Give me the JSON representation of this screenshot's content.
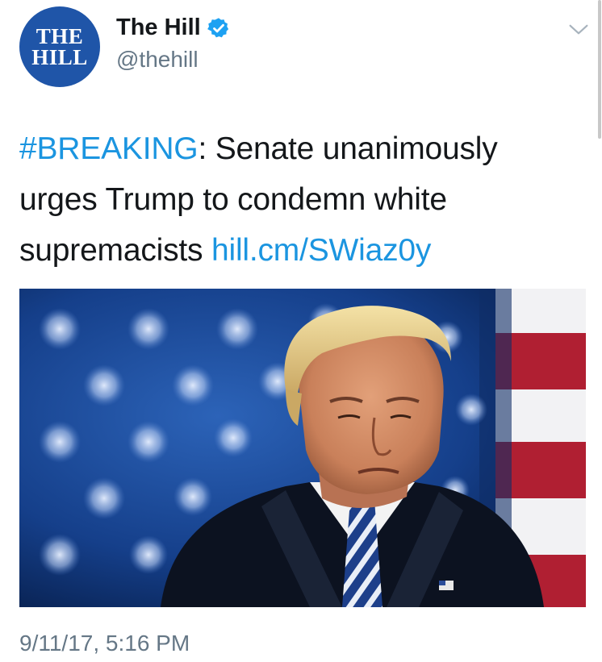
{
  "author": {
    "avatar_line1": "THE",
    "avatar_line2": "HILL",
    "name": "The Hill",
    "handle": "@thehill",
    "verified": true,
    "avatar_color": "#1f55a8"
  },
  "tweet": {
    "hashtag": "#BREAKING",
    "text_part1": ": Senate unanimously urges Trump to condemn white supremacists ",
    "link": "hill.cm/SWiaz0y",
    "link_color": "#1b95e0",
    "timestamp": "9/11/17, 5:16 PM"
  },
  "icons": {
    "verified": "verified-badge-icon",
    "menu": "chevron-down-icon"
  }
}
